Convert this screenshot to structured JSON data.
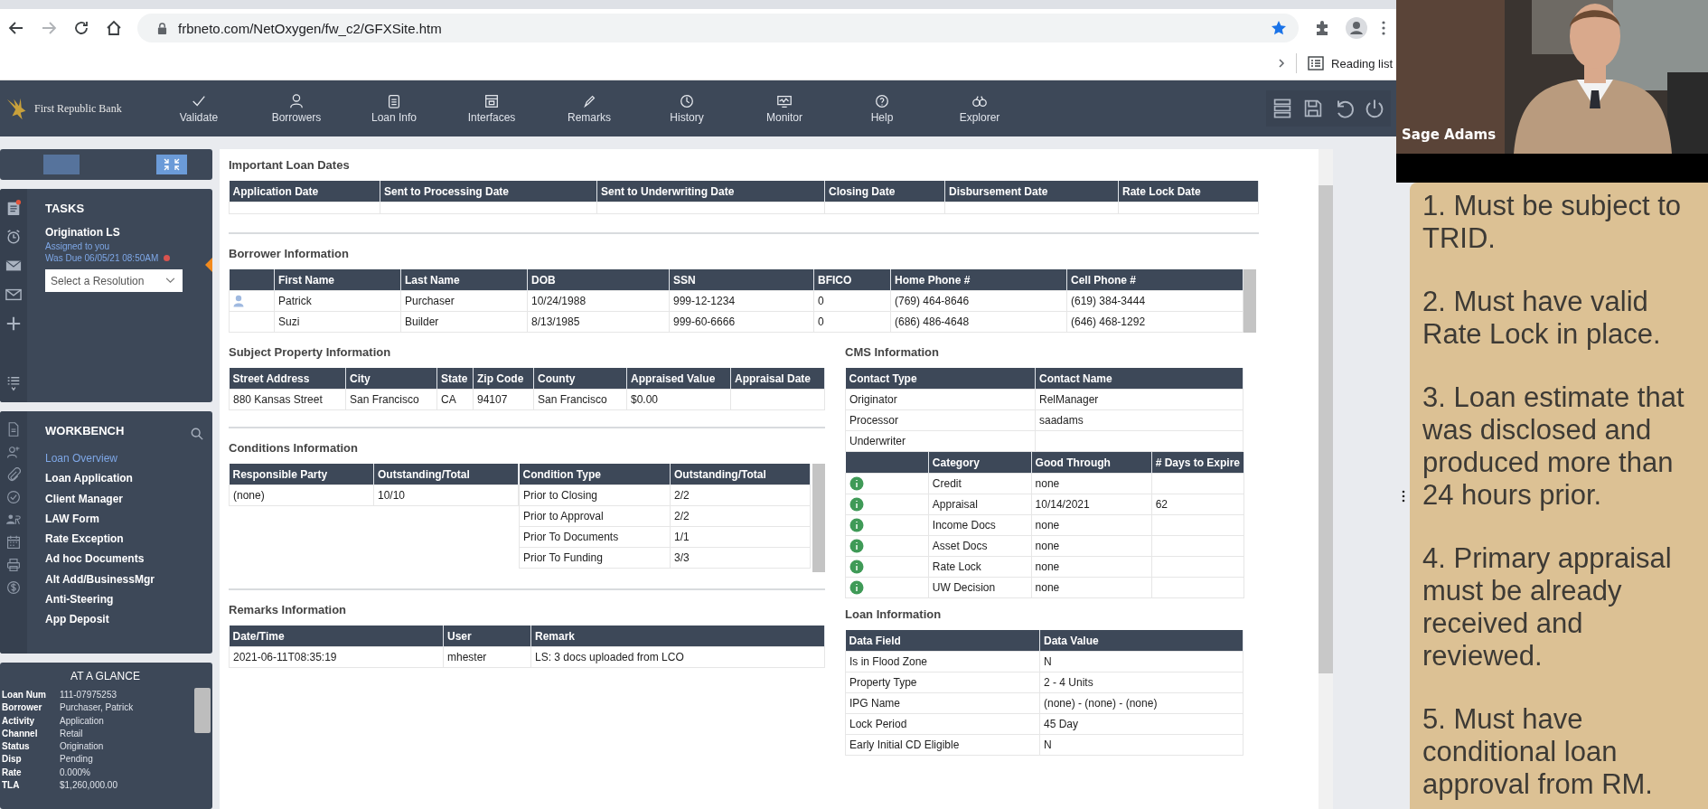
{
  "browser": {
    "url": "frbneto.com/NetOxygen/fw_c2/GFXSite.htm",
    "reading_list": "Reading list"
  },
  "app_bar": {
    "logo": "First Republic Bank",
    "nav": [
      "Validate",
      "Borrowers",
      "Loan Info",
      "Interfaces",
      "Remarks",
      "History",
      "Monitor",
      "Help",
      "Explorer"
    ]
  },
  "tasks": {
    "title": "TASKS",
    "task": "Origination LS",
    "assigned": "Assigned to you",
    "due": "Was Due 06/05/21 08:50AM",
    "overdue": true,
    "resolution": {
      "placeholder": "Select a Resolution"
    }
  },
  "workbench": {
    "title": "WORKBENCH",
    "items": [
      {
        "label": "Loan Overview",
        "selected": true
      },
      {
        "label": "Loan Application",
        "selected": false
      },
      {
        "label": "Client Manager",
        "selected": false
      },
      {
        "label": "LAW Form",
        "selected": false
      },
      {
        "label": "Rate Exception",
        "selected": false
      },
      {
        "label": "Ad hoc Documents",
        "selected": false
      },
      {
        "label": "Alt Add/BusinessMgr",
        "selected": false
      },
      {
        "label": "Anti-Steering",
        "selected": false
      },
      {
        "label": "App Deposit",
        "selected": false
      }
    ]
  },
  "at_a_glance": {
    "title": "AT A GLANCE",
    "rows": [
      {
        "label": "Loan Num",
        "value": "111-07975253"
      },
      {
        "label": "Borrower",
        "value": "Purchaser, Patrick"
      },
      {
        "label": "Activity",
        "value": "Application"
      },
      {
        "label": "Channel",
        "value": "Retail"
      },
      {
        "label": "Status",
        "value": "Origination"
      },
      {
        "label": "Disp",
        "value": "Pending"
      },
      {
        "label": "Rate",
        "value": "0.000%"
      },
      {
        "label": "TLA",
        "value": "$1,260,000.00"
      }
    ]
  },
  "important_loan_dates": {
    "title": "Important Loan Dates",
    "columns": [
      "Application Date",
      "Sent to Processing Date",
      "Sent to Underwriting Date",
      "Closing Date",
      "Disbursement Date",
      "Rate Lock Date"
    ]
  },
  "borrower_information": {
    "title": "Borrower Information",
    "columns": [
      "First Name",
      "Last Name",
      "DOB",
      "SSN",
      "BFICO",
      "Home Phone #",
      "Cell Phone #"
    ],
    "rows": [
      {
        "primary": true,
        "cells": [
          "Patrick",
          "Purchaser",
          "10/24/1988",
          "999-12-1234",
          "0",
          "(769) 464-8646",
          "(619) 384-3444"
        ]
      },
      {
        "primary": false,
        "cells": [
          "Suzi",
          "Builder",
          "8/13/1985",
          "999-60-6666",
          "0",
          "(686) 486-4648",
          "(646) 468-1292"
        ]
      }
    ]
  },
  "subject_property_information": {
    "title": "Subject Property Information",
    "columns": [
      "Street Address",
      "City",
      "State",
      "Zip Code",
      "County",
      "Appraised Value",
      "Appraisal Date"
    ],
    "rows": [
      [
        "880 Kansas Street",
        "San Francisco",
        "CA",
        "94107",
        "San Francisco",
        "$0.00"
      ]
    ]
  },
  "cms_information": {
    "title": "CMS Information",
    "columns": [
      "Contact Type",
      "Contact Name"
    ],
    "rows": [
      [
        "Originator",
        "RelManager"
      ],
      [
        "Processor",
        "saadams"
      ],
      [
        "Underwriter"
      ]
    ],
    "category_columns": [
      "Category",
      "Good Through",
      "# Days to Expire"
    ],
    "categories": [
      [
        "Credit",
        "none"
      ],
      [
        "Appraisal",
        "10/14/2021",
        "62"
      ],
      [
        "Income Docs",
        "none"
      ],
      [
        "Asset Docs",
        "none"
      ],
      [
        "Rate Lock",
        "none"
      ],
      [
        "UW Decision",
        "none"
      ]
    ]
  },
  "conditions_information": {
    "title": "Conditions Information",
    "party_columns": [
      "Responsible Party",
      "Outstanding/Total"
    ],
    "parties": [
      [
        "(none)",
        "10/10"
      ]
    ],
    "type_columns": [
      "Condition Type",
      "Outstanding/Total"
    ],
    "types": [
      [
        "Prior to Closing",
        "2/2"
      ],
      [
        "Prior to Approval",
        "2/2"
      ],
      [
        "Prior To Documents",
        "1/1"
      ],
      [
        "Prior To Funding",
        "3/3"
      ]
    ]
  },
  "remarks_information": {
    "title": "Remarks Information",
    "columns": [
      "Date/Time",
      "User",
      "Remark"
    ],
    "rows": [
      [
        "2021-06-11T08:35:19",
        "mhester",
        "LS: 3 docs uploaded from LCO"
      ]
    ]
  },
  "loan_information": {
    "title": "Loan Information",
    "columns": [
      "Data Field",
      "Data Value"
    ],
    "rows": [
      [
        "Is in Flood Zone",
        "N"
      ],
      [
        "Property Type",
        "2 - 4 Units"
      ],
      [
        "IPG Name",
        "(none) - (none) - (none)"
      ],
      [
        "Lock Period",
        "45 Day"
      ],
      [
        "Early Initial CD Eligible",
        "N"
      ]
    ]
  },
  "video": {
    "name": "Sage Adams"
  },
  "notes": [
    "1. Must be subject to TRID.",
    "2. Must have valid Rate Lock in place.",
    "3. Loan estimate that was disclosed and produced more than 24 hours prior.",
    "4. Primary appraisal must be already received and reviewed.",
    "5. Must have conditional loan approval from RM."
  ]
}
